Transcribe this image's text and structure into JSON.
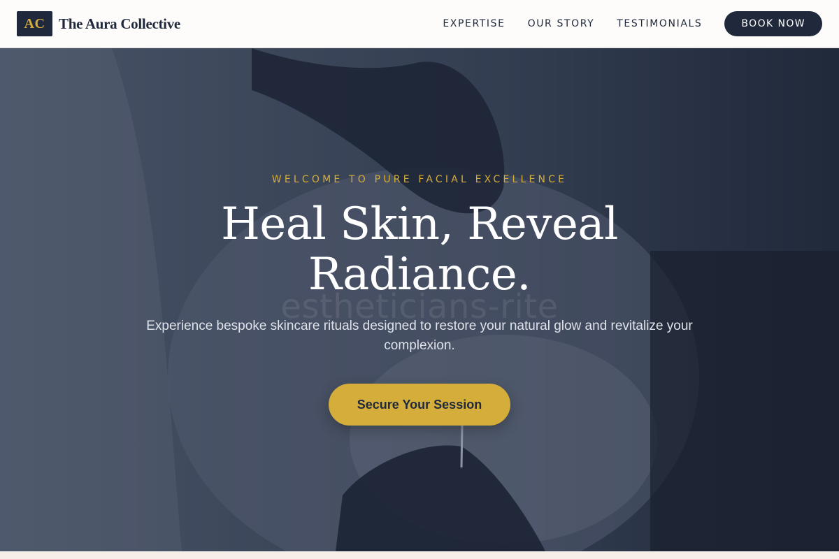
{
  "header": {
    "logo_initials": "AC",
    "brand_name": "The Aura Collective",
    "nav": [
      {
        "label": "EXPERTISE"
      },
      {
        "label": "OUR STORY"
      },
      {
        "label": "TESTIMONIALS"
      }
    ],
    "book_label": "BOOK NOW"
  },
  "hero": {
    "eyebrow": "WELCOME TO PURE FACIAL EXCELLENCE",
    "headline": "Heal Skin, Reveal Radiance.",
    "ghost_text": "estheticians-rite",
    "subtext": "Experience bespoke skincare rituals designed to restore your natural glow and revitalize your complexion.",
    "cta_label": "Secure Your Session"
  },
  "colors": {
    "navy": "#1f293b",
    "gold": "#d4ad3b",
    "header_bg": "#fdfcfb"
  }
}
